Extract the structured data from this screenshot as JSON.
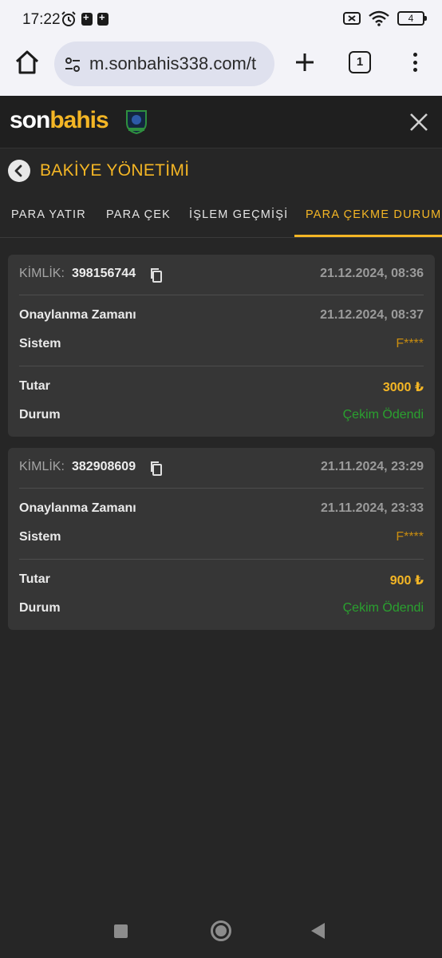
{
  "status_bar": {
    "time": "17:22",
    "battery": "4"
  },
  "browser": {
    "url": "m.sonbahis338.com/t",
    "tab_count": "1"
  },
  "site": {
    "logo_son": "son",
    "logo_bahis": "bahis"
  },
  "page": {
    "title": "BAKİYE YÖNETİMİ"
  },
  "tabs": [
    {
      "label": "PARA YATIR"
    },
    {
      "label": "PARA ÇEK"
    },
    {
      "label": "İŞLEM GEÇMİŞİ"
    },
    {
      "label": "PARA ÇEKME DURUMU"
    }
  ],
  "labels": {
    "kimlik": "KİMLİK:",
    "approval_time": "Onaylanma Zamanı",
    "system": "Sistem",
    "amount": "Tutar",
    "status": "Durum"
  },
  "withdrawals": [
    {
      "id": "398156744",
      "created": "21.12.2024, 08:36",
      "approved": "21.12.2024, 08:37",
      "system": "F****",
      "amount": "3000 ₺",
      "status": "Çekim Ödendi"
    },
    {
      "id": "382908609",
      "created": "21.11.2024, 23:29",
      "approved": "21.11.2024, 23:33",
      "system": "F****",
      "amount": "900 ₺",
      "status": "Çekim Ödendi"
    }
  ],
  "colors": {
    "accent": "#f4b625",
    "paid": "#2aa12f",
    "system": "#c98d10",
    "background": "#262626",
    "card": "#363636"
  }
}
